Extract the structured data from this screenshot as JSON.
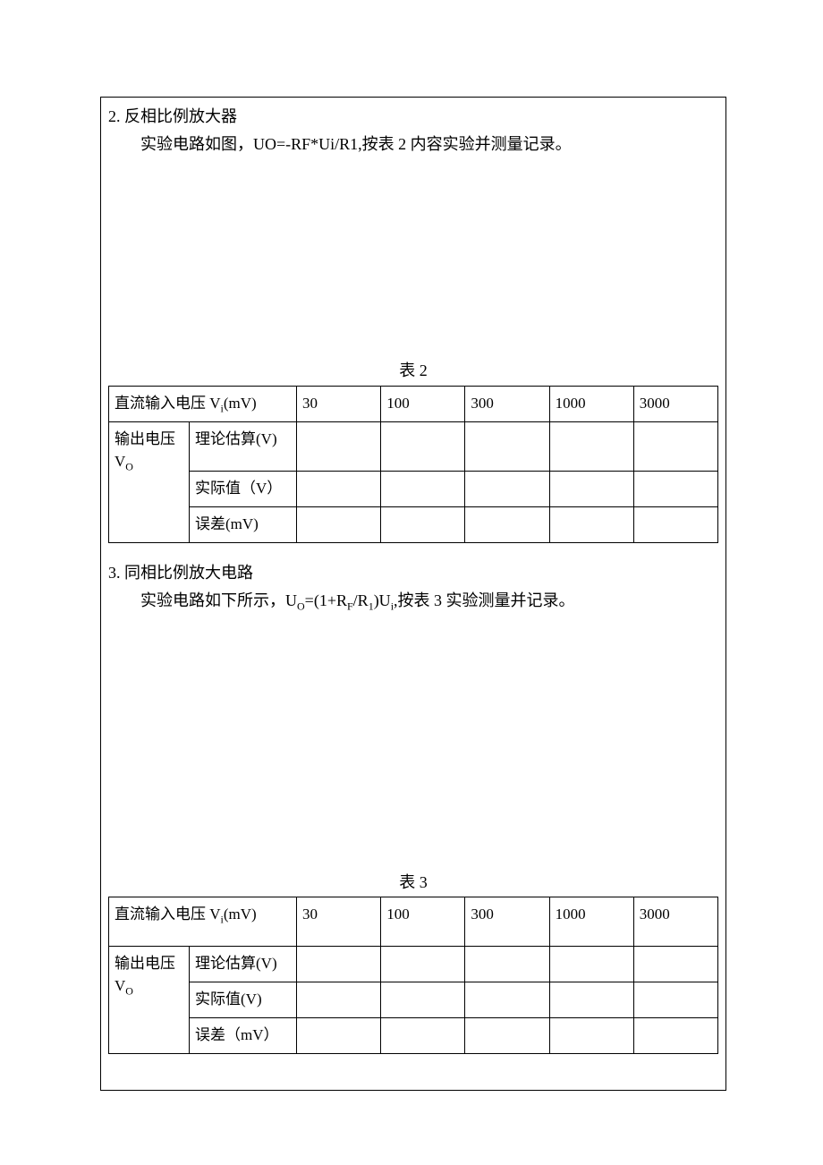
{
  "section2": {
    "title": "2. 反相比例放大器",
    "body_prefix": "实验电路如图，UO=-RF*Ui/R1,按",
    "body_ref": "表 2",
    "body_suffix": " 内容实验并测量记录。"
  },
  "table2": {
    "caption": "表 2",
    "header_label_prefix": "直流输入电压 V",
    "header_label_sub": "i",
    "header_label_unit": "(mV)",
    "cols": [
      "30",
      "100",
      "300",
      "1000",
      "3000"
    ],
    "vo_label_prefix": "输出电压",
    "vo_label_symbol_prefix": "V",
    "vo_label_symbol_sub": "O",
    "rows": [
      {
        "label": "理论估算(V)",
        "values": [
          "",
          "",
          "",
          "",
          ""
        ]
      },
      {
        "label": "实际值（V）",
        "values": [
          "",
          "",
          "",
          "",
          ""
        ]
      },
      {
        "label": "误差(mV)",
        "values": [
          "",
          "",
          "",
          "",
          ""
        ]
      }
    ]
  },
  "section3": {
    "title": "3. 同相比例放大电路",
    "body_prefix": "实验电路如下所示，U",
    "body_idx_o": "O",
    "body_eq1": "=(1+R",
    "body_idx_f": "F",
    "body_eq2": "/R",
    "body_idx_1": "1",
    "body_eq3": ")U",
    "body_idx_i": "i",
    "body_suffix": ",按表 3 实验测量并记录。"
  },
  "table3": {
    "caption": "表 3",
    "header_label_prefix": "直流输入电压 V",
    "header_label_sub": "i",
    "header_label_unit": "(mV)",
    "cols": [
      "30",
      "100",
      "300",
      "1000",
      "3000"
    ],
    "vo_label_prefix": "输出电压",
    "vo_label_symbol_prefix": "V",
    "vo_label_symbol_sub": "O",
    "rows": [
      {
        "label": "理论估算(V)",
        "values": [
          "",
          "",
          "",
          "",
          ""
        ]
      },
      {
        "label": "实际值(V)",
        "values": [
          "",
          "",
          "",
          "",
          ""
        ]
      },
      {
        "label": "误差（mV）",
        "values": [
          "",
          "",
          "",
          "",
          ""
        ]
      }
    ]
  }
}
